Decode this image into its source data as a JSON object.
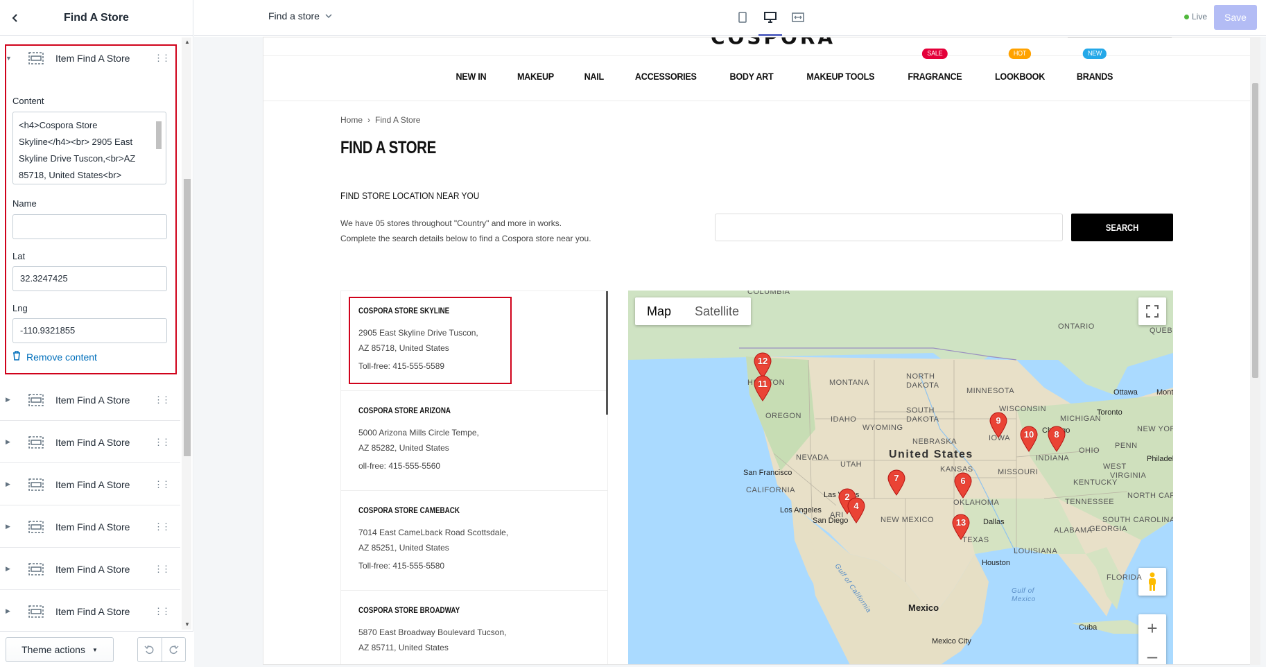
{
  "sidebar": {
    "title": "Find A Store",
    "expanded_item_label": "Item Find A Store",
    "content_label": "Content",
    "content_value": "<h4>Cospora Store Skyline</h4><br> 2905 East Skyline Drive Tuscon,<br>AZ 85718, United States<br>",
    "name_label": "Name",
    "name_value": "",
    "lat_label": "Lat",
    "lat_value": "32.3247425",
    "lng_label": "Lng",
    "lng_value": "-110.9321855",
    "remove_label": "Remove content",
    "collapsed_items": [
      "Item Find A Store",
      "Item Find A Store",
      "Item Find A Store",
      "Item Find A Store",
      "Item Find A Store",
      "Item Find A Store"
    ],
    "theme_actions": "Theme actions"
  },
  "topbar": {
    "page_select": "Find a store",
    "live_label": "Live",
    "save_label": "Save"
  },
  "site": {
    "logo_text": "COSPORA",
    "nav": [
      {
        "label": "NEW IN",
        "badge": null
      },
      {
        "label": "MAKEUP",
        "badge": null
      },
      {
        "label": "NAIL",
        "badge": null
      },
      {
        "label": "ACCESSORIES",
        "badge": null
      },
      {
        "label": "BODY ART",
        "badge": null
      },
      {
        "label": "MAKEUP TOOLS",
        "badge": null
      },
      {
        "label": "FRAGRANCE",
        "badge": "Sale",
        "badge_color": "#e4003a"
      },
      {
        "label": "LOOKBOOK",
        "badge": "Hot",
        "badge_color": "#ffa200"
      },
      {
        "label": "BRANDS",
        "badge": "New",
        "badge_color": "#24a8e8"
      }
    ],
    "breadcrumb_home": "Home",
    "breadcrumb_current": "Find A Store",
    "page_title": "FIND A STORE",
    "sub_title": "FIND STORE LOCATION NEAR YOU",
    "desc_line1": "We have 05 stores throughout \"Country\" and more in works.",
    "desc_line2": "Complete the search details below to find a Cospora store near you.",
    "search_button": "SEARCH",
    "stores": [
      {
        "name": "COSPORA STORE SKYLINE",
        "addr1": "2905 East Skyline Drive Tuscon,",
        "addr2": "AZ 85718, United States",
        "phone": "Toll-free: 415-555-5589"
      },
      {
        "name": "COSPORA STORE ARIZONA",
        "addr1": "5000 Arizona Mills Circle Tempe,",
        "addr2": "AZ 85282, United States",
        "phone": "oll-free: 415-555-5560"
      },
      {
        "name": "COSPORA STORE CAMEBACK",
        "addr1": "7014 East CameLback Road Scottsdale,",
        "addr2": "AZ 85251, United States",
        "phone": "Toll-free: 415-555-5580"
      },
      {
        "name": "COSPORA STORE BROADWAY",
        "addr1": "5870 East Broadway Boulevard Tucson,",
        "addr2": "AZ 85711, United States",
        "phone": ""
      }
    ]
  },
  "map": {
    "tab_map": "Map",
    "tab_satellite": "Satellite",
    "labels": {
      "columbia": "COLUMBIA",
      "ontario": "ONTARIO",
      "quebec": "QUEBEC",
      "washington": "HINGTON",
      "montana": "MONTANA",
      "north_dakota_1": "NORTH",
      "north_dakota_2": "DAKOTA",
      "minnesota": "MINNESOTA",
      "ottawa": "Ottawa",
      "montreal": "Mont",
      "oregon": "OREGON",
      "idaho": "IDAHO",
      "south_dakota_1": "SOUTH",
      "south_dakota_2": "DAKOTA",
      "wisconsin": "WISCONSIN",
      "michigan": "MICHIGAN",
      "toronto": "Toronto",
      "new_york": "NEW YORK",
      "wyoming": "WYOMING",
      "iowa": "IOWA",
      "chicago": "Chicago",
      "nebraska": "NEBRASKA",
      "nevada": "NEVADA",
      "united_states": "United States",
      "indiana": "INDIANA",
      "ohio": "OHIO",
      "penn": "PENN",
      "philadelphia": "Philadelp",
      "utah": "UTAH",
      "kansas": "KANSAS",
      "missouri": "MISSOURI",
      "san_francisco": "San Francisco",
      "kentucky": "KENTUCKY",
      "virginia": "VIRGINIA",
      "west": "WEST",
      "california": "CALIFORNIA",
      "las_vegas": "Las Vegas",
      "oklahoma": "OKLAHOMA",
      "tennessee": "TENNESSEE",
      "north_carolina": "NORTH CAROLINA",
      "los_angeles": "Los Angeles",
      "arizona": "ARI",
      "new_mexico": "NEW MEXICO",
      "dallas": "Dallas",
      "south_carolina": "SOUTH CAROLINA",
      "san_diego": "San Diego",
      "alabama": "ALABAMA",
      "georgia": "GEORGIA",
      "texas": "TEXAS",
      "louisiana": "LOUISIANA",
      "houston": "Houston",
      "florida": "FLORIDA",
      "gulf_california": "Gulf of California",
      "gulf_mexico_1": "Gulf of",
      "gulf_mexico_2": "Mexico",
      "mexico": "Mexico",
      "cuba": "Cuba",
      "mexico_city": "Mexico City"
    },
    "pins": [
      "12",
      "11",
      "9",
      "10",
      "8",
      "7",
      "6",
      "2",
      "4",
      "13"
    ]
  }
}
